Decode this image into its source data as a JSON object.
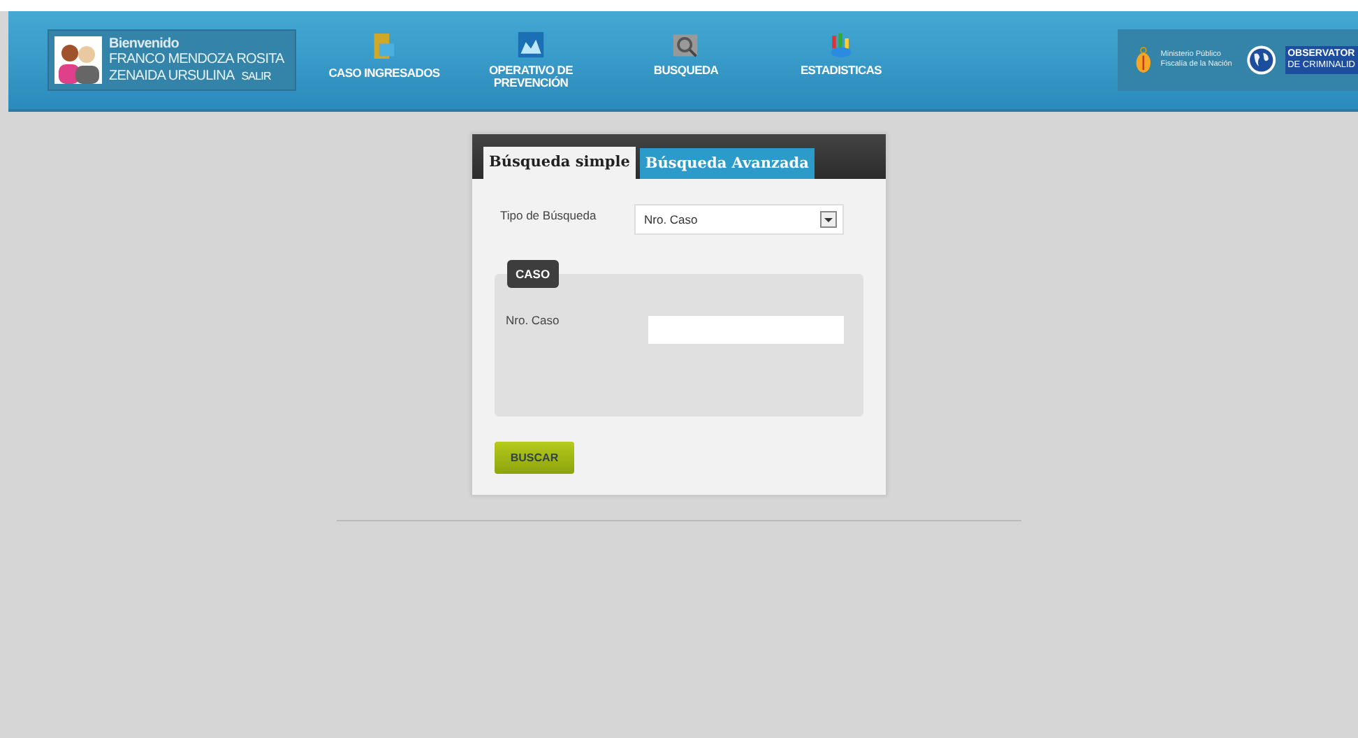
{
  "user": {
    "greeting": "Bienvenido",
    "name_line_1": "FRANCO MENDOZA ROSITA",
    "name_line_2": "ZENAIDA URSULINA",
    "logout": "SALIR"
  },
  "nav": [
    {
      "kind": "folder",
      "label": "CASO INGRESADOS"
    },
    {
      "kind": "chart",
      "label": "OPERATIVO DE PREVENCIÓN"
    },
    {
      "kind": "search",
      "label": "BUSQUEDA"
    },
    {
      "kind": "stats",
      "label": "ESTADISTICAS"
    }
  ],
  "logos": {
    "ministry_line_1": "Ministerio Público",
    "ministry_line_2": "Fiscalía de la Nación",
    "observatory_line_1": "OBSERVATOR",
    "observatory_line_2": "DE CRIMINALID"
  },
  "tabs": [
    {
      "label": "Búsqueda simple",
      "selected": true
    },
    {
      "label": "Búsqueda Avanzada",
      "selected": false
    }
  ],
  "search_type": {
    "label": "Tipo de Búsqueda",
    "value": "Nro. Caso"
  },
  "case_group": {
    "legend": "CASO",
    "field_label": "Nro. Caso"
  },
  "submit": "BUSCAR"
}
